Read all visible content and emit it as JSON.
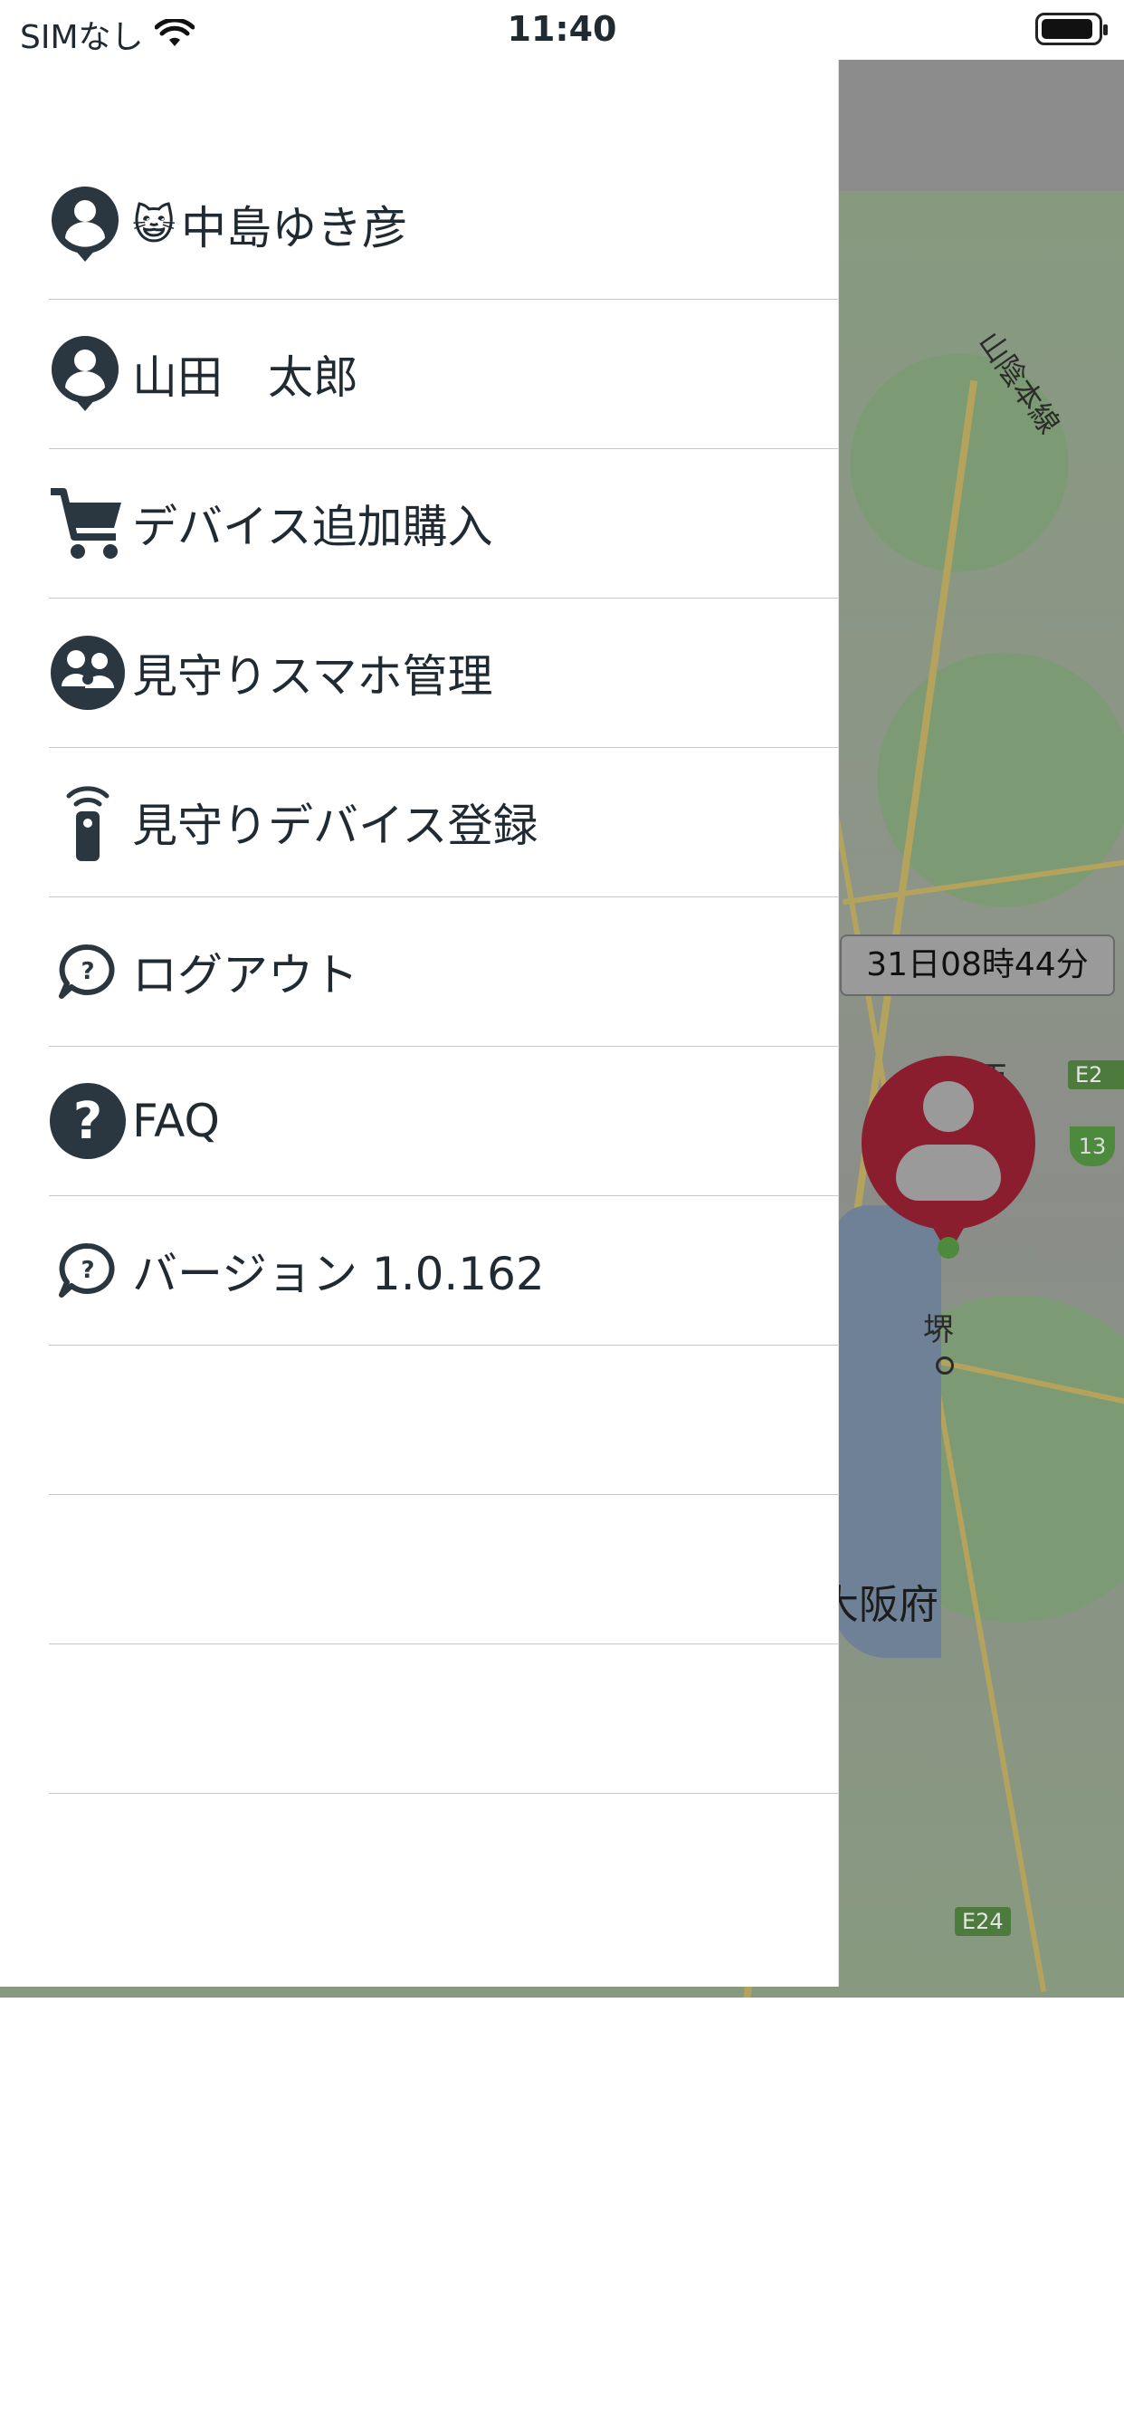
{
  "status_bar": {
    "carrier": "SIMなし",
    "time": "11:40"
  },
  "map": {
    "rail_label": "山陰本線",
    "prefecture_label": "大阪府",
    "city_label": "堺",
    "partial_label": "西",
    "highway_labels": [
      "E24",
      "E2",
      "13"
    ],
    "location_time": "31日08時44分",
    "marker_color": "#8a1e2e"
  },
  "drawer": {
    "items": [
      {
        "icon": "user-pin-icon",
        "emoji": "😺",
        "label": "中島ゆき彦"
      },
      {
        "icon": "user-pin-icon",
        "label": "山田　太郎"
      },
      {
        "icon": "cart-icon",
        "label": "デバイス追加購入"
      },
      {
        "icon": "family-icon",
        "label": "見守りスマホ管理"
      },
      {
        "icon": "remote-device-icon",
        "label": "見守りデバイス登録"
      },
      {
        "icon": "question-bubble-icon",
        "label": "ログアウト"
      },
      {
        "icon": "question-circle-icon",
        "label": "FAQ"
      },
      {
        "icon": "question-bubble-icon",
        "label": "バージョン 1.0.162"
      }
    ],
    "text_color": "#1f2a33",
    "divider_color": "#c9c9c9"
  }
}
